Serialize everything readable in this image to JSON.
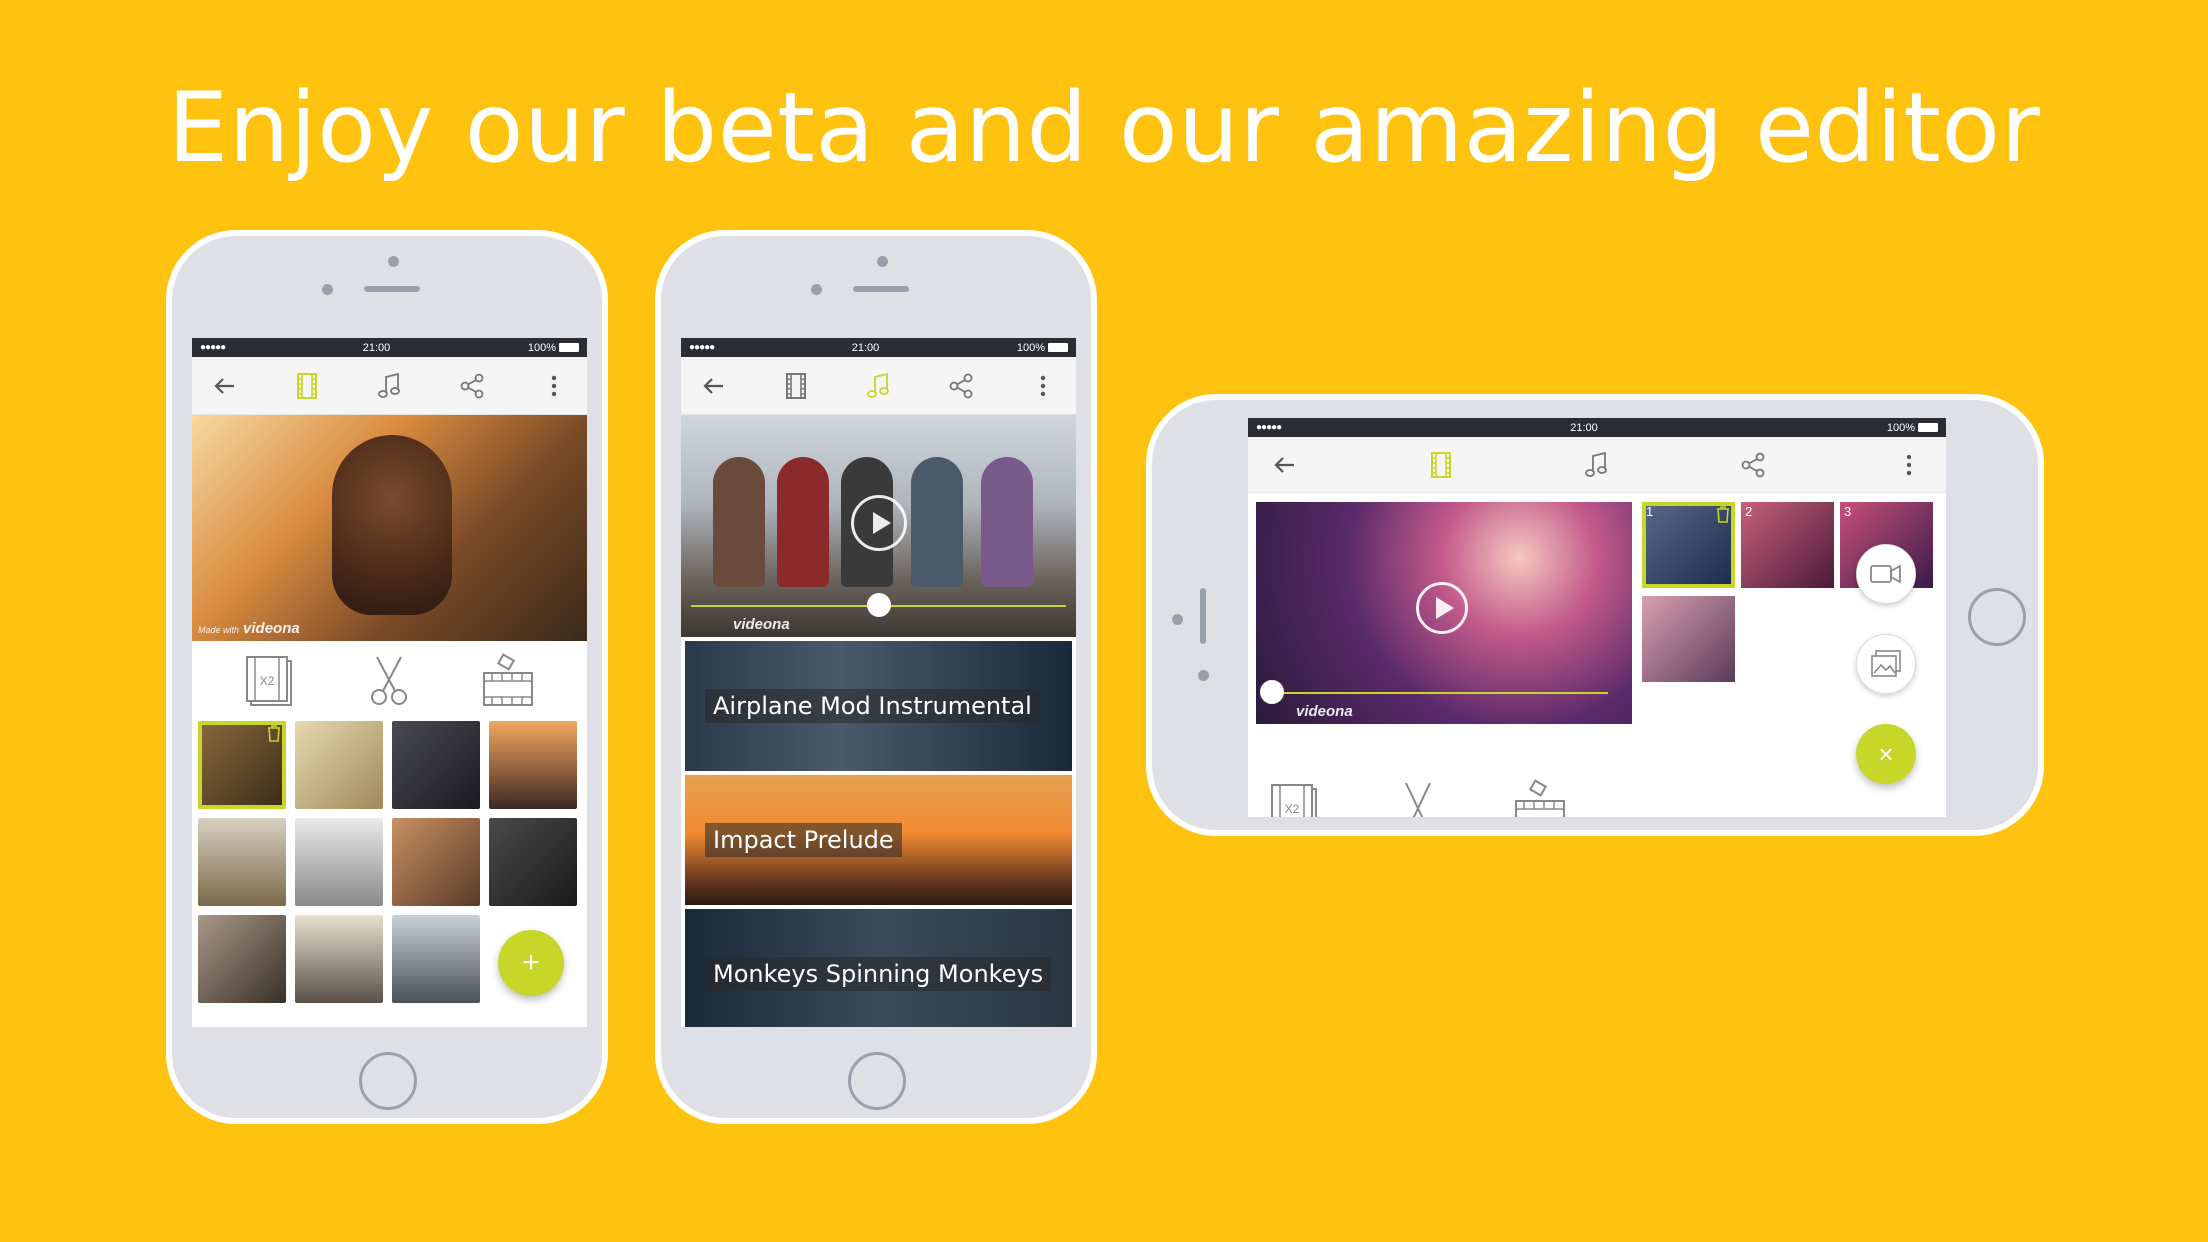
{
  "headline": "Enjoy our beta and our amazing editor",
  "colors": {
    "background": "#FFC20E",
    "accent": "#C8D629",
    "statusbar": "#2b2d35"
  },
  "statusbar": {
    "time": "21:00",
    "battery": "100%",
    "signal": "●●●●●"
  },
  "toolbar": {
    "icons": [
      "back-arrow-icon",
      "film-icon",
      "music-note-icon",
      "share-icon",
      "more-vert-icon"
    ]
  },
  "watermark": {
    "made_with": "Made with",
    "brand": "videona"
  },
  "editor_tools": {
    "speed_badge": "X2",
    "icons": [
      "speed-icon",
      "scissors-icon",
      "duplicate-clip-icon"
    ]
  },
  "phone1": {
    "active_tab": "film",
    "fab_label": "+"
  },
  "phone2": {
    "active_tab": "music",
    "tracks": [
      {
        "title": "Airplane Mod Instrumental"
      },
      {
        "title": "Impact Prelude"
      },
      {
        "title": "Monkeys Spinning Monkeys"
      }
    ]
  },
  "phone3": {
    "active_tab": "film",
    "clip_numbers": [
      "1",
      "2",
      "3"
    ],
    "fab_label": "×",
    "side_actions": [
      "video-camera-icon",
      "gallery-icon"
    ]
  }
}
